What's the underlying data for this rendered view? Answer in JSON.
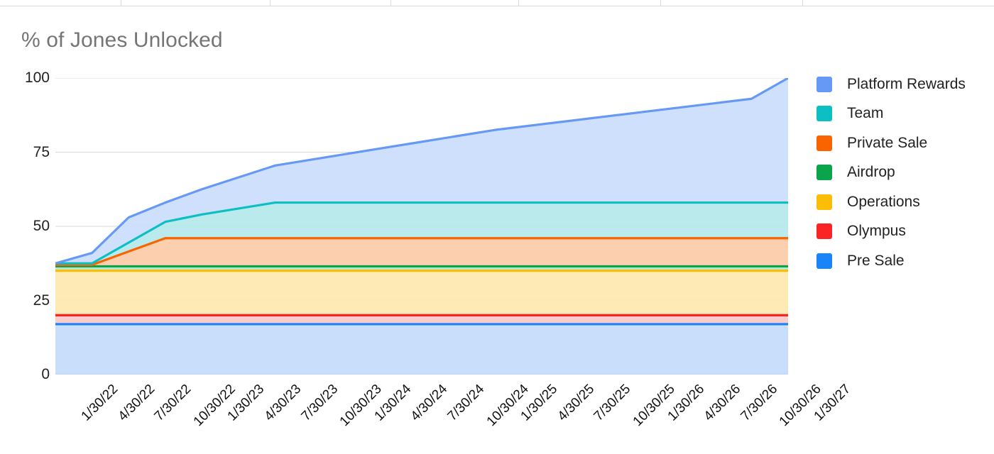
{
  "chart_title": "% of Jones Unlocked",
  "legend": {
    "items": [
      {
        "label": "Platform Rewards",
        "color": "#6699f5"
      },
      {
        "label": "Team",
        "color": "#0dbfc4"
      },
      {
        "label": "Private Sale",
        "color": "#fa6400"
      },
      {
        "label": "Airdrop",
        "color": "#0aa44a"
      },
      {
        "label": "Operations",
        "color": "#fcbd09"
      },
      {
        "label": "Olympus",
        "color": "#fb2424"
      },
      {
        "label": "Pre Sale",
        "color": "#1a83f7"
      }
    ]
  },
  "chart_data": {
    "type": "area",
    "title": "% of Jones Unlocked",
    "subtitle": "",
    "xlabel": "",
    "ylabel": "",
    "stacked": true,
    "grid": true,
    "legend_position": "right",
    "ylim": [
      0,
      100
    ],
    "yticks": [
      0,
      25,
      50,
      75,
      100
    ],
    "ytick_labels": [
      "0",
      "25",
      "50",
      "75",
      "100"
    ],
    "categories": [
      "1/30/22",
      "4/30/22",
      "7/30/22",
      "10/30/22",
      "1/30/23",
      "4/30/23",
      "7/30/23",
      "10/30/23",
      "1/30/24",
      "4/30/24",
      "7/30/24",
      "10/30/24",
      "1/30/25",
      "4/30/25",
      "7/30/25",
      "10/30/25",
      "1/30/26",
      "4/30/26",
      "7/30/26",
      "10/30/26",
      "1/30/27"
    ],
    "series": [
      {
        "name": "Pre Sale",
        "color": "#1a83f7",
        "fill": "#c5dcfb",
        "values": [
          17,
          17,
          17,
          17,
          17,
          17,
          17,
          17,
          17,
          17,
          17,
          17,
          17,
          17,
          17,
          17,
          17,
          17,
          17,
          17,
          17
        ]
      },
      {
        "name": "Olympus",
        "color": "#fb2424",
        "fill": "#fbc9c9",
        "values": [
          3,
          3,
          3,
          3,
          3,
          3,
          3,
          3,
          3,
          3,
          3,
          3,
          3,
          3,
          3,
          3,
          3,
          3,
          3,
          3,
          3
        ]
      },
      {
        "name": "Operations",
        "color": "#fcbd09",
        "fill": "#fde9b0",
        "values": [
          15,
          15,
          15,
          15,
          15,
          15,
          15,
          15,
          15,
          15,
          15,
          15,
          15,
          15,
          15,
          15,
          15,
          15,
          15,
          15,
          15
        ]
      },
      {
        "name": "Airdrop",
        "color": "#0aa44a",
        "fill": "#b7e5c7",
        "values": [
          1.5,
          1.5,
          1.5,
          1.5,
          1.5,
          1.5,
          1.5,
          1.5,
          1.5,
          1.5,
          1.5,
          1.5,
          1.5,
          1.5,
          1.5,
          1.5,
          1.5,
          1.5,
          1.5,
          1.5,
          1.5
        ]
      },
      {
        "name": "Private Sale",
        "color": "#fa6400",
        "fill": "#fcccab",
        "values": [
          0.5,
          0.5,
          5.0,
          9.5,
          9.5,
          9.5,
          9.5,
          9.5,
          9.5,
          9.5,
          9.5,
          9.5,
          9.5,
          9.5,
          9.5,
          9.5,
          9.5,
          9.5,
          9.5,
          9.5,
          9.5
        ]
      },
      {
        "name": "Team",
        "color": "#0dbfc4",
        "fill": "#b6e9ea",
        "values": [
          0.5,
          0.5,
          3.0,
          5.5,
          8.0,
          10.0,
          12.0,
          12.0,
          12.0,
          12.0,
          12.0,
          12.0,
          12.0,
          12.0,
          12.0,
          12.0,
          12.0,
          12.0,
          12.0,
          12.0,
          12.0
        ]
      },
      {
        "name": "Platform Rewards",
        "color": "#6699f5",
        "fill": "#cbdefb",
        "values": [
          0.5,
          4.0,
          8.5,
          16.0,
          19.5,
          23.0,
          28.5,
          30.5,
          32.5,
          34.5,
          36.5,
          38.5,
          40.5,
          42.0,
          43.5,
          45.0,
          46.5,
          48.0,
          49.5,
          51.0,
          42.0
        ]
      }
    ],
    "cumulative_top": [
      37.5,
      41.0,
      53.0,
      58.0,
      62.5,
      66.5,
      70.5,
      72.5,
      74.5,
      76.5,
      78.5,
      80.5,
      82.5,
      84.0,
      85.5,
      87.0,
      88.5,
      90.0,
      91.5,
      93.0,
      100.0
    ],
    "annotations": []
  }
}
